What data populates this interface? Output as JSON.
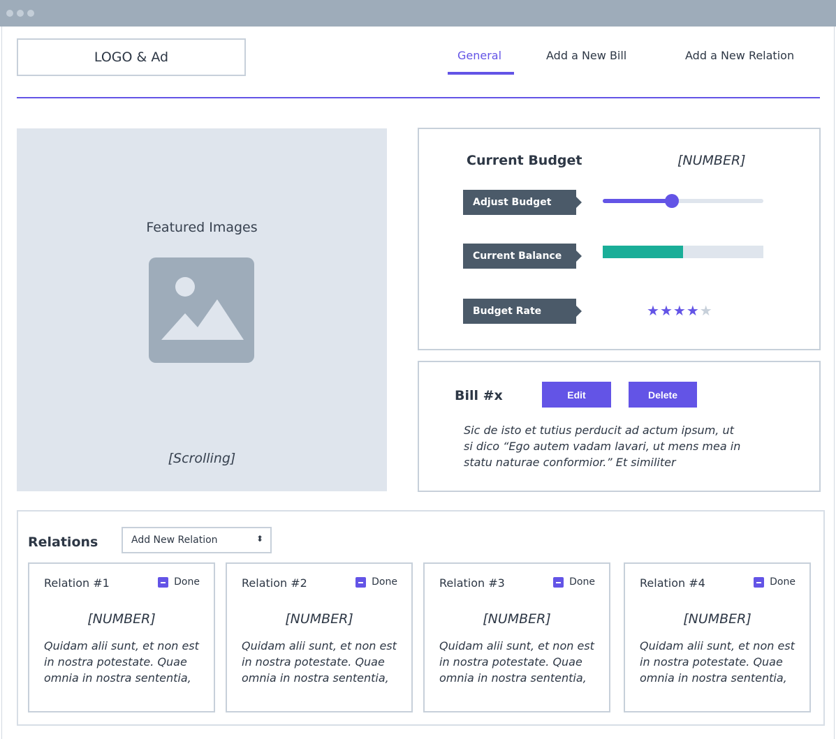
{
  "header": {
    "logo_text": "LOGO & Ad",
    "nav": [
      {
        "label": "General",
        "active": true
      },
      {
        "label": "Add a New Bill",
        "active": false
      },
      {
        "label": "Add a New Relation",
        "active": false
      }
    ]
  },
  "featured": {
    "title": "Featured Images",
    "icon": "image-placeholder-icon",
    "caption": "[Scrolling]"
  },
  "budget": {
    "title": "Current Budget",
    "value": "[NUMBER]",
    "adjust_label": "Adjust Budget",
    "adjust_level": 0.43,
    "balance_label": "Current Balance",
    "balance_level": 0.5,
    "rate_label": "Budget Rate",
    "rate_stars": 4,
    "rate_max": 5
  },
  "bill": {
    "title": "Bill #x",
    "edit_label": "Edit",
    "delete_label": "Delete",
    "text": "Sic de isto et tutius perducit ad actum ipsum, ut si dico “Ego autem vadam lavari, ut mens mea in statu naturae conformior.” Et similiter"
  },
  "relations": {
    "title": "Relations",
    "select_value": "Add New Relation",
    "cards": [
      {
        "title": "Relation #1",
        "done_label": "Done",
        "number": "[NUMBER]",
        "text": "Quidam alii sunt, et non est in nostra potestate. Quae omnia in nostra sententia,"
      },
      {
        "title": "Relation #2",
        "done_label": "Done",
        "number": "[NUMBER]",
        "text": "Quidam alii sunt, et non est in nostra potestate. Quae omnia in nostra sententia,"
      },
      {
        "title": "Relation #3",
        "done_label": "Done",
        "number": "[NUMBER]",
        "text": "Quidam alii sunt, et non est in nostra potestate. Quae omnia in nostra sententia,"
      },
      {
        "title": "Relation #4",
        "done_label": "Done",
        "number": "[NUMBER]",
        "text": "Quidam alii sunt, et non est in nostra potestate. Quae omnia in nostra sententia,"
      }
    ]
  },
  "colors": {
    "accent": "#6354e6",
    "progress": "#1aae98",
    "tag": "#4b5a69",
    "star_off": "#c7d0da"
  }
}
